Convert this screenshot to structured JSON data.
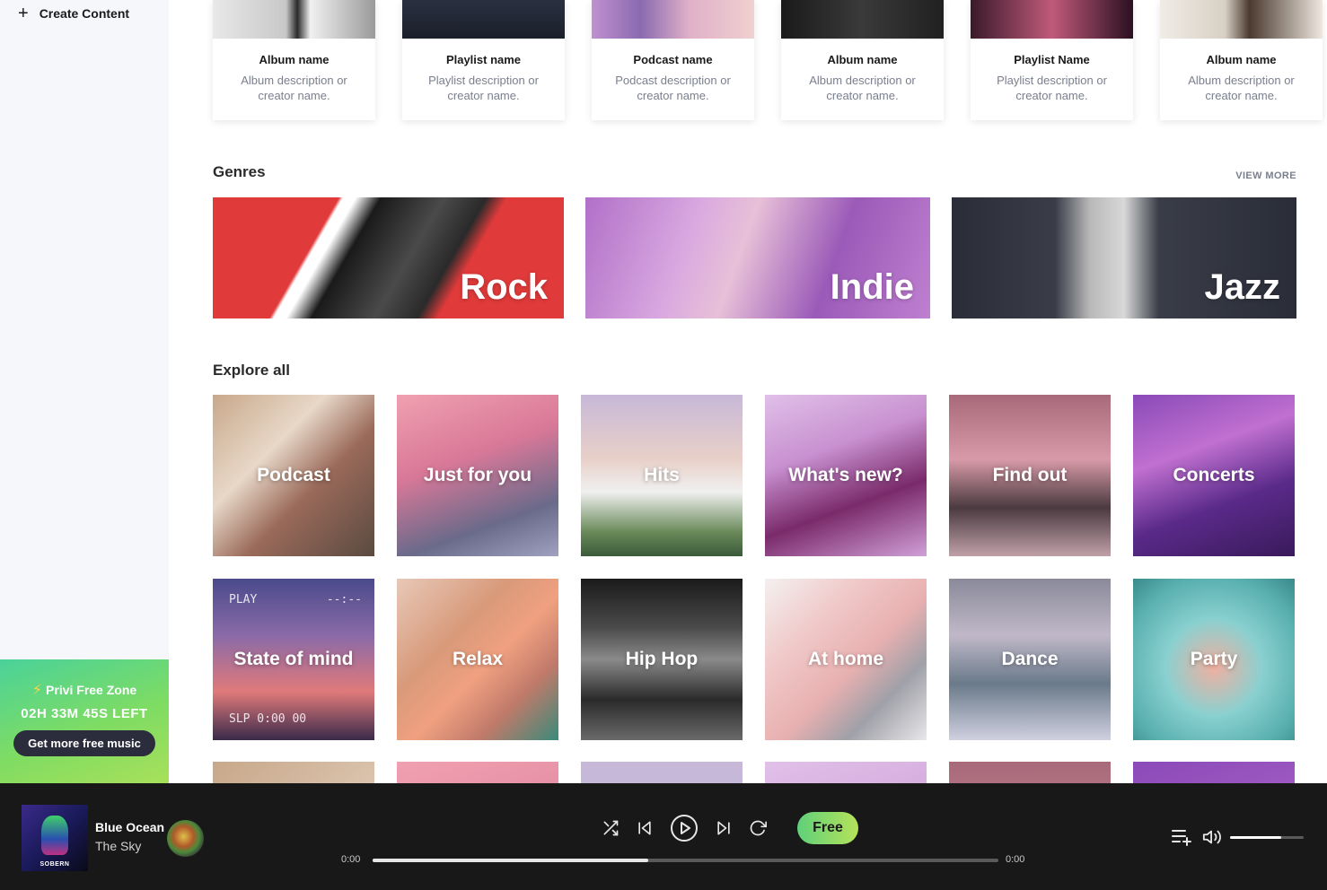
{
  "sidebar": {
    "create_label": "Create Content",
    "freezone": {
      "title": "Privi Free Zone",
      "timer": "02H 33M 45S LEFT",
      "button_label": "Get more free music"
    }
  },
  "cards": [
    {
      "title": "Album name",
      "desc": "Album description or creator name."
    },
    {
      "title": "Playlist name",
      "desc": "Playlist description or creator name."
    },
    {
      "title": "Podcast name",
      "desc": "Podcast description or creator name."
    },
    {
      "title": "Album name",
      "desc": "Album description or creator name."
    },
    {
      "title": "Playlist Name",
      "desc": "Playlist description or creator name."
    },
    {
      "title": "Album name",
      "desc": "Album description or creator name."
    }
  ],
  "genres": {
    "title": "Genres",
    "view_more": "VIEW MORE",
    "items": [
      {
        "label": "Rock"
      },
      {
        "label": "Indie"
      },
      {
        "label": "Jazz"
      }
    ]
  },
  "explore": {
    "title": "Explore all",
    "row1": [
      {
        "label": "Podcast"
      },
      {
        "label": "Just for you"
      },
      {
        "label": "Hits"
      },
      {
        "label": "What's new?"
      },
      {
        "label": "Find out"
      },
      {
        "label": "Concerts"
      }
    ],
    "row2": [
      {
        "label": "State of mind",
        "overlay_top_left": "PLAY",
        "overlay_top_right": "--:--",
        "overlay_bottom": "SLP 0:00 00"
      },
      {
        "label": "Relax"
      },
      {
        "label": "Hip Hop"
      },
      {
        "label": "At home"
      },
      {
        "label": "Dance"
      },
      {
        "label": "Party"
      }
    ]
  },
  "player": {
    "cover_text": "SOBERN",
    "track_title": "Blue Ocean",
    "track_artist": "The Sky",
    "free_label": "Free",
    "time_current": "0:00",
    "time_total": "0:00",
    "progress": 0.44,
    "volume": 0.7
  },
  "colors": {
    "player_bg": "#181818",
    "sidebar_bg": "#f6f7fb",
    "accent_green": "#7edc63"
  }
}
